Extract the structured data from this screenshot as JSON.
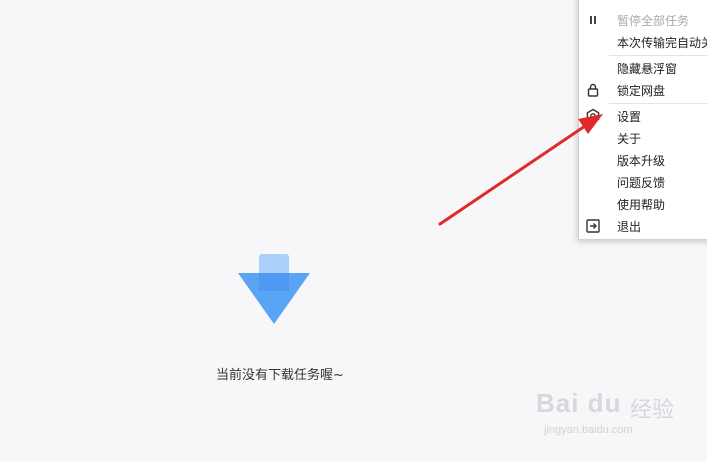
{
  "empty_state": {
    "message": "当前没有下载任务喔~"
  },
  "menu": {
    "items": [
      {
        "label": "暂停全部任务",
        "icon": "pause-icon",
        "disabled": true
      },
      {
        "label": "本次传输完自动关机",
        "icon": "",
        "disabled": false
      },
      {
        "label": "隐藏悬浮窗",
        "icon": "",
        "disabled": false
      },
      {
        "label": "锁定网盘",
        "icon": "lock-icon",
        "disabled": false
      },
      {
        "label": "设置",
        "icon": "gear-icon",
        "disabled": false
      },
      {
        "label": "关于",
        "icon": "",
        "disabled": false
      },
      {
        "label": "版本升级",
        "icon": "",
        "disabled": false
      },
      {
        "label": "问题反馈",
        "icon": "",
        "disabled": false
      },
      {
        "label": "使用帮助",
        "icon": "",
        "disabled": false
      },
      {
        "label": "退出",
        "icon": "exit-icon",
        "disabled": false
      }
    ]
  },
  "watermark": {
    "logo": "Bai du",
    "site": "经验",
    "url": "jingyan.baidu.com"
  },
  "colors": {
    "arrow_annotation": "#e02a2a",
    "download_icon_blue": "#5aa4f6"
  }
}
